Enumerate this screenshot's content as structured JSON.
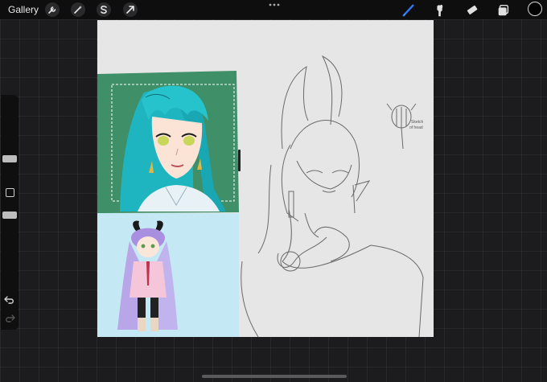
{
  "topbar": {
    "gallery_label": "Gallery",
    "left_tools": [
      "wrench-icon",
      "magic-wand-icon",
      "selection-s-icon",
      "transform-arrow-icon"
    ],
    "right_tools": [
      "brush-icon",
      "smudge-icon",
      "eraser-icon",
      "layers-icon"
    ],
    "active_tool": "brush-icon",
    "active_color": "#000000",
    "accent": "#2f7bf5"
  },
  "sidebar": {
    "controls": [
      "brush-size-slider",
      "modify-button",
      "opacity-slider",
      "undo-icon",
      "redo-icon"
    ]
  },
  "canvas": {
    "background": "#e6e6e6",
    "panels": {
      "portrait_bg": "#3f8f68",
      "chibi_bg": "#c5e9f4"
    },
    "sketch_note": "Sketch of head"
  }
}
